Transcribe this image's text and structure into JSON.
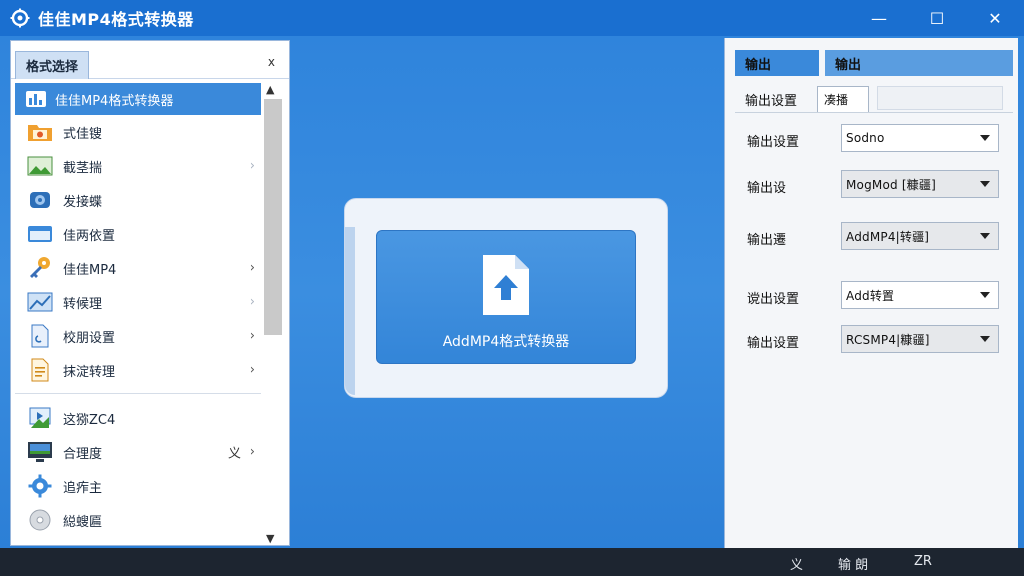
{
  "titlebar": {
    "app_icon": "gear-icon",
    "title": "佳佳MP4格式转换器",
    "minimize": "—",
    "maximize": "☐",
    "close": "✕"
  },
  "left_panel": {
    "tab_label": "格式选择",
    "close_label": "x",
    "scroll_up": "▲",
    "scroll_down": "▼",
    "items": [
      {
        "label": "佳佳MP4格式转换器",
        "icon": "app-icon",
        "chevron": "",
        "extra": ""
      },
      {
        "label": "式佳锼",
        "icon": "folder-icon",
        "chevron": "",
        "extra": ""
      },
      {
        "label": "截茎揣",
        "icon": "image-icon",
        "chevron": "›",
        "extra": ""
      },
      {
        "label": "发接蝶",
        "icon": "disc-icon",
        "chevron": "",
        "extra": ""
      },
      {
        "label": "佳两依置",
        "icon": "window-icon",
        "chevron": "",
        "extra": ""
      },
      {
        "label": "佳佳MP4",
        "icon": "key-icon",
        "chevron": "›",
        "extra": ""
      },
      {
        "label": "转候理",
        "icon": "chart-icon",
        "chevron": "›",
        "extra": ""
      },
      {
        "label": "校朋设置",
        "icon": "document-icon",
        "chevron": "›",
        "extra": ""
      },
      {
        "label": "抹淀转理",
        "icon": "notes-icon",
        "chevron": "›",
        "extra": ""
      },
      {
        "label": "这猕ZC4",
        "icon": "play-icon",
        "chevron": "",
        "extra": ""
      },
      {
        "label": "合理度",
        "icon": "monitor-icon",
        "chevron": "›",
        "extra": "义"
      },
      {
        "label": "追痄主",
        "icon": "settings-icon",
        "chevron": "",
        "extra": ""
      },
      {
        "label": "縂螋匾",
        "icon": "cd-icon",
        "chevron": "",
        "extra": ""
      }
    ]
  },
  "center": {
    "drop_label": "AddMP4格式转换器",
    "drop_icon": "file-upload-icon"
  },
  "right_panel": {
    "header_left": "输出",
    "header_right": "输出",
    "tab_active": "输出设置",
    "tab_second": "凑播",
    "rows": [
      {
        "label": "输出设置",
        "value": "Sodno"
      },
      {
        "label": "输出设",
        "value": "MogMod [糠疆]"
      },
      {
        "label": "输出遷",
        "value": "AddMP4|转疆]"
      },
      {
        "label": "谠出设置",
        "value": "Add转置"
      },
      {
        "label": "输出设置",
        "value": "RCSMP4|糠疆]"
      }
    ]
  },
  "statusbar": {
    "item1": "义",
    "item2": "输 朗",
    "item3": "ZR"
  }
}
